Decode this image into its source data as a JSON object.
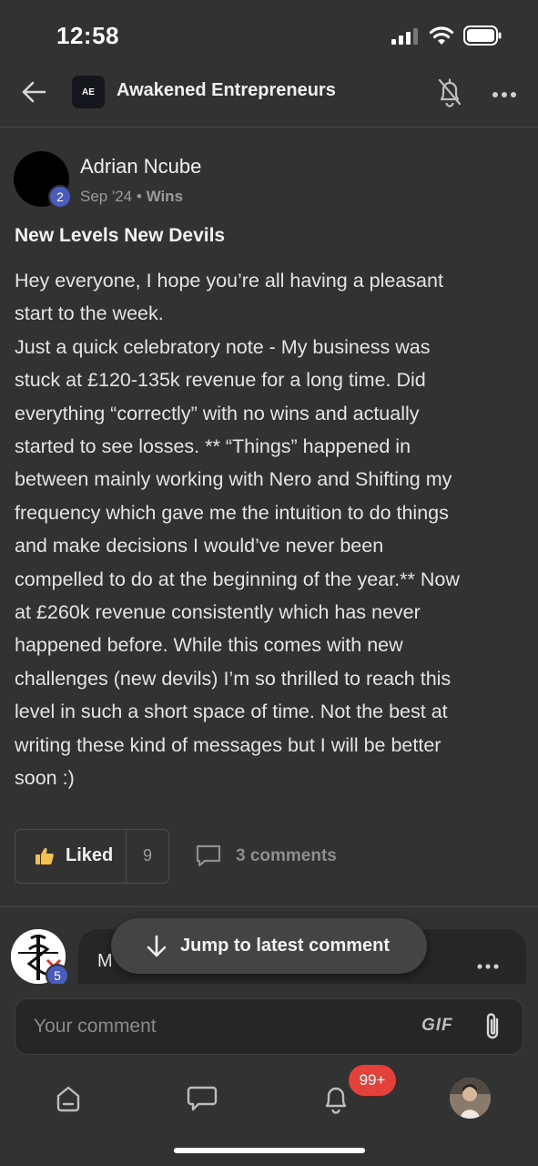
{
  "status_bar": {
    "time": "12:58"
  },
  "header": {
    "group_logo_text": "AE",
    "group_name": "Awakened Entrepreneurs"
  },
  "post": {
    "author": "Adrian Ncube",
    "author_level": "2",
    "date": "Sep '24",
    "separator": "•",
    "category": "Wins",
    "title": "New Levels New Devils",
    "body": "Hey everyone, I hope you’re all having a pleasant\nstart to the week.\nJust a quick celebratory note - My business was\nstuck at £120-135k revenue for a long time. Did\neverything “correctly” with no wins and actually\nstarted to see losses. ** “Things” happened in\nbetween mainly working with Nero and Shifting my\nfrequency which gave me the intuition to do things\nand make decisions I would’ve never been\ncompelled to do at the beginning of the year.** Now\nat £260k revenue consistently which has never\nhappened before. While this comes with new\nchallenges (new devils) I’m so thrilled to reach this\nlevel in such a short space of time. Not the best at\nwriting these kind of messages but I will be better\nsoon :)",
    "liked_label": "Liked",
    "like_count": "9",
    "comments_label": "3 comments"
  },
  "comment_preview": {
    "author_partial": "M",
    "author_level": "5"
  },
  "jump_button": {
    "label": "Jump to latest comment"
  },
  "composer": {
    "placeholder": "Your comment",
    "gif_label": "GIF"
  },
  "bottom_nav": {
    "notification_badge": "99+"
  },
  "colors": {
    "background": "#323232",
    "level_badge": "#4a5bbf",
    "notification_badge": "#e4413a",
    "like_thumb": "#f2c14e"
  }
}
